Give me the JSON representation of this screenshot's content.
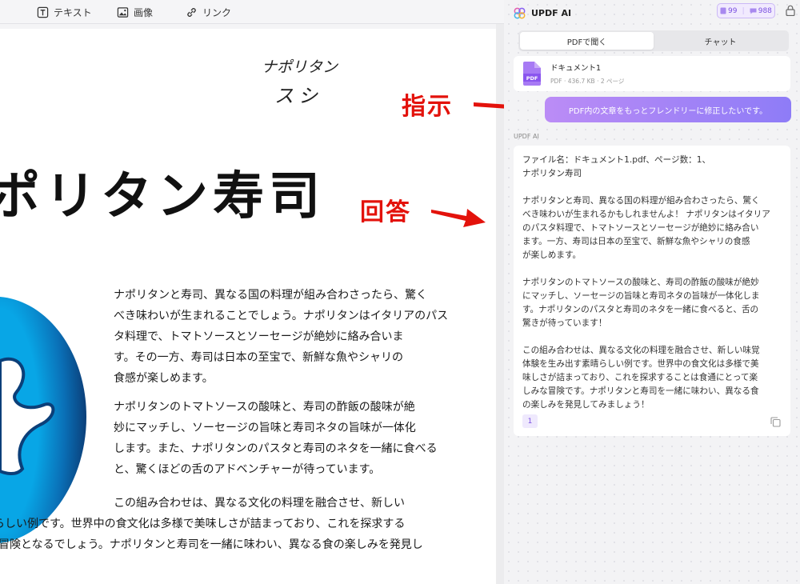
{
  "toolbar": {
    "text_label": "テキスト",
    "image_label": "画像",
    "link_label": "リンク"
  },
  "document": {
    "handwriting_line1": "ナポリタン",
    "handwriting_line2": "スシ",
    "title": "ポリタン寿司",
    "para1": [
      "ナポリタンと寿司、異なる国の料理が組み合わさったら、驚く",
      "べき味わいが生まれることでしょう。ナポリタンはイタリアのパス",
      "タ料理で、トマトソースとソーセージが絶妙に絡み合いま",
      "す。その一方、寿司は日本の至宝で、新鮮な魚やシャリの",
      "食感が楽しめます。"
    ],
    "para2": [
      "ナポリタンのトマトソースの酸味と、寿司の酢飯の酸味が絶",
      "妙にマッチし、ソーセージの旨味と寿司ネタの旨味が一体化",
      "します。また、ナポリタンのパスタと寿司のネタを一緒に食べる",
      "と、驚くほどの舌のアドベンチャーが待っています。"
    ],
    "para3": [
      "この組み合わせは、異なる文化の料理を融合させ、新しい",
      "晴らしい例です。世界中の食文化は多様で美味しさが詰まっており、これを探求する",
      "な冒険となるでしょう。ナポリタンと寿司を一緒に味わい、異なる食の楽しみを発見し"
    ]
  },
  "annotations": {
    "instruction": "指示",
    "answer": "回答",
    "color": "#e3120b"
  },
  "panel": {
    "title": "UPDF AI",
    "credit_1": "99",
    "credit_2": "988",
    "tab_pdf": "PDFで聞く",
    "tab_chat": "チャット",
    "file_name": "ドキュメント1",
    "file_meta": "PDF · 436.7 KB · 2 ページ",
    "prompt": "PDF内の文章をもっとフレンドリーに修正したいです。",
    "section_label": "UPDF AI",
    "answer_lines": [
      "ファイル名：ドキュメント1.pdf、ページ数：1、",
      "ナポリタン寿司",
      "",
      "ナポリタンと寿司、異なる国の料理が組み合わさったら、驚く",
      "べき味わいが生まれるかもしれませんよ！ ナポリタンはイタリア",
      "のパスタ料理で、トマトソースとソーセージが絶妙に絡み合い",
      "ます。一方、寿司は日本の至宝で、新鮮な魚やシャリの食感",
      "が楽しめます。",
      "",
      "ナポリタンのトマトソースの酸味と、寿司の酢飯の酸味が絶妙",
      "にマッチし、ソーセージの旨味と寿司ネタの旨味が一体化しま",
      "す。ナポリタンのパスタと寿司のネタを一緒に食べると、舌の",
      "驚きが待っています！",
      "",
      "この組み合わせは、異なる文化の料理を融合させ、新しい味覚",
      "体験を生み出す素晴らしい例です。世界中の食文化は多様で美",
      "味しさが詰まっており、これを探求することは食通にとって楽",
      "しみな冒険です。ナポリタンと寿司を一緒に味わい、異なる食",
      "の楽しみを発見してみましょう！"
    ],
    "page_ref": "1",
    "accent_color": "#7a4fe0"
  }
}
